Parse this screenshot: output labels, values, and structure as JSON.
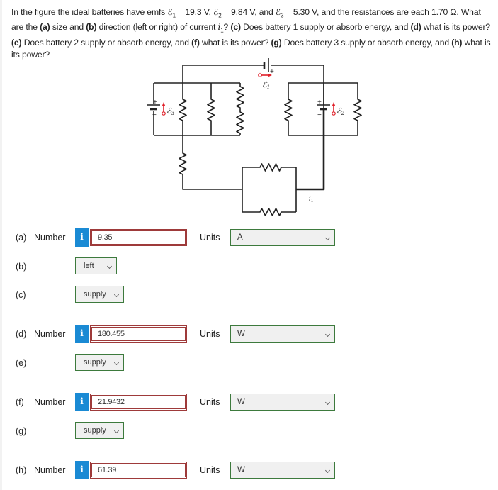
{
  "question": {
    "segments": [
      {
        "t": "In the figure the ideal batteries have emfs ℰ",
        "b": false
      },
      {
        "t": "1",
        "sub": true
      },
      {
        "t": " = 19.3 V, ℰ",
        "b": false
      },
      {
        "t": "2",
        "sub": true
      },
      {
        "t": " = 9.84 V, and ℰ",
        "b": false
      },
      {
        "t": "3",
        "sub": true
      },
      {
        "t": " = 5.30 V, and the resistances are each 1.70 Ω. What are the ",
        "b": false
      },
      {
        "t": "(a)",
        "b": true
      },
      {
        "t": " size and ",
        "b": false
      },
      {
        "t": "(b)",
        "b": true
      },
      {
        "t": " direction (left or right) of current ",
        "b": false
      },
      {
        "t": "i",
        "i": true
      },
      {
        "t": "1",
        "sub": true
      },
      {
        "t": "? ",
        "b": false
      },
      {
        "t": "(c)",
        "b": true
      },
      {
        "t": " Does battery 1 supply or absorb energy, and ",
        "b": false
      },
      {
        "t": "(d)",
        "b": true
      },
      {
        "t": " what is its power? ",
        "b": false
      },
      {
        "t": "(e)",
        "b": true
      },
      {
        "t": " Does battery 2 supply or absorb energy, and ",
        "b": false
      },
      {
        "t": "(f)",
        "b": true
      },
      {
        "t": " what is its power? ",
        "b": false
      },
      {
        "t": "(g)",
        "b": true
      },
      {
        "t": " Does battery 3 supply or absorb energy, and ",
        "b": false
      },
      {
        "t": "(h)",
        "b": true
      },
      {
        "t": " what is its power?",
        "b": false
      }
    ]
  },
  "figure": {
    "emf1_label": "ℰ",
    "emf1_sub": "1",
    "emf2_label": "ℰ",
    "emf2_sub": "2",
    "emf3_label": "ℰ",
    "emf3_sub": "3",
    "current_label": "i",
    "current_sub": "1",
    "plus": "+",
    "minus": "−",
    "arrow_color": "#e0202a",
    "wire_color": "#222222"
  },
  "answers": {
    "a": {
      "part": "(a)",
      "number_label": "Number",
      "info_icon": "i",
      "value": "9.35",
      "units_label": "Units",
      "unit": "A"
    },
    "b": {
      "part": "(b)",
      "selected": "left"
    },
    "c": {
      "part": "(c)",
      "selected": "supply"
    },
    "d": {
      "part": "(d)",
      "number_label": "Number",
      "info_icon": "i",
      "value": "180.455",
      "units_label": "Units",
      "unit": "W"
    },
    "e": {
      "part": "(e)",
      "selected": "supply"
    },
    "f": {
      "part": "(f)",
      "number_label": "Number",
      "info_icon": "i",
      "value": "21.9432",
      "units_label": "Units",
      "unit": "W"
    },
    "g": {
      "part": "(g)",
      "selected": "supply"
    },
    "h": {
      "part": "(h)",
      "number_label": "Number",
      "info_icon": "i",
      "value": "61.39",
      "units_label": "Units",
      "unit": "W"
    }
  },
  "colors": {
    "info_blue": "#1a8ad4",
    "input_border_red": "#9e3a3a",
    "select_border_green": "#3d7a3d"
  }
}
